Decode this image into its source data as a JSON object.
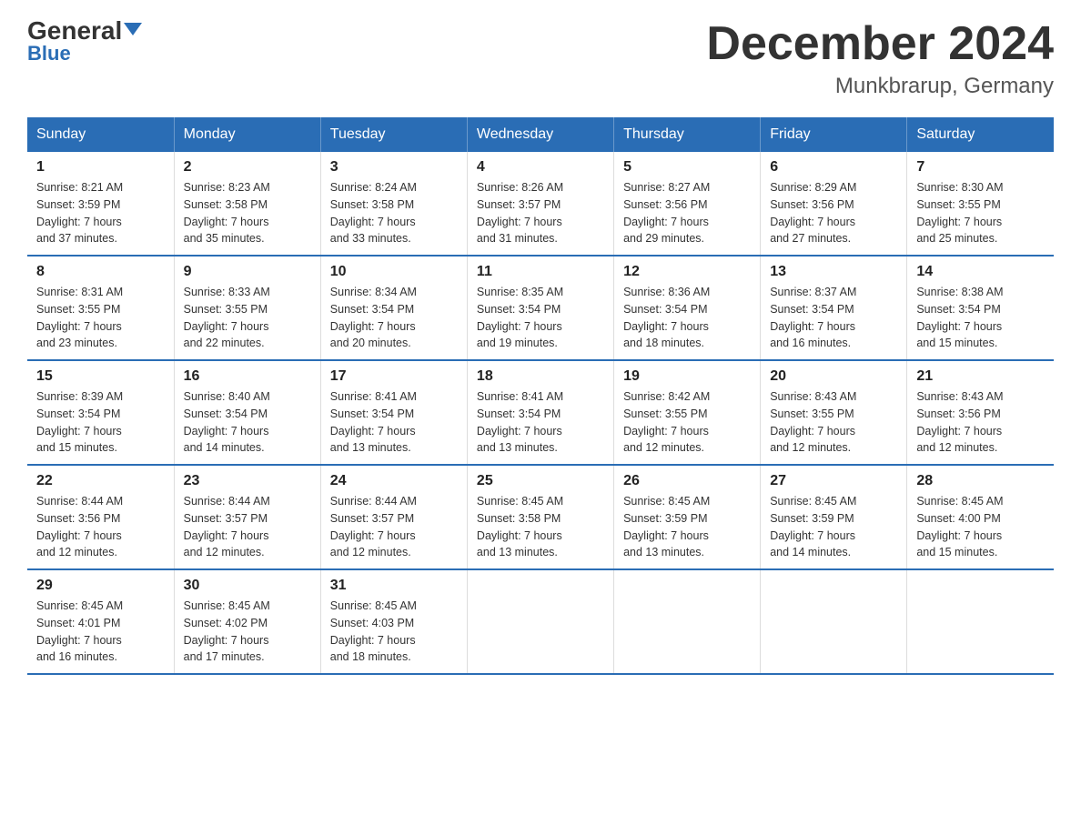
{
  "header": {
    "logo_general": "General",
    "logo_blue": "Blue",
    "main_title": "December 2024",
    "subtitle": "Munkbrarup, Germany"
  },
  "days_of_week": [
    "Sunday",
    "Monday",
    "Tuesday",
    "Wednesday",
    "Thursday",
    "Friday",
    "Saturday"
  ],
  "weeks": [
    [
      {
        "day": "1",
        "info": "Sunrise: 8:21 AM\nSunset: 3:59 PM\nDaylight: 7 hours\nand 37 minutes."
      },
      {
        "day": "2",
        "info": "Sunrise: 8:23 AM\nSunset: 3:58 PM\nDaylight: 7 hours\nand 35 minutes."
      },
      {
        "day": "3",
        "info": "Sunrise: 8:24 AM\nSunset: 3:58 PM\nDaylight: 7 hours\nand 33 minutes."
      },
      {
        "day": "4",
        "info": "Sunrise: 8:26 AM\nSunset: 3:57 PM\nDaylight: 7 hours\nand 31 minutes."
      },
      {
        "day": "5",
        "info": "Sunrise: 8:27 AM\nSunset: 3:56 PM\nDaylight: 7 hours\nand 29 minutes."
      },
      {
        "day": "6",
        "info": "Sunrise: 8:29 AM\nSunset: 3:56 PM\nDaylight: 7 hours\nand 27 minutes."
      },
      {
        "day": "7",
        "info": "Sunrise: 8:30 AM\nSunset: 3:55 PM\nDaylight: 7 hours\nand 25 minutes."
      }
    ],
    [
      {
        "day": "8",
        "info": "Sunrise: 8:31 AM\nSunset: 3:55 PM\nDaylight: 7 hours\nand 23 minutes."
      },
      {
        "day": "9",
        "info": "Sunrise: 8:33 AM\nSunset: 3:55 PM\nDaylight: 7 hours\nand 22 minutes."
      },
      {
        "day": "10",
        "info": "Sunrise: 8:34 AM\nSunset: 3:54 PM\nDaylight: 7 hours\nand 20 minutes."
      },
      {
        "day": "11",
        "info": "Sunrise: 8:35 AM\nSunset: 3:54 PM\nDaylight: 7 hours\nand 19 minutes."
      },
      {
        "day": "12",
        "info": "Sunrise: 8:36 AM\nSunset: 3:54 PM\nDaylight: 7 hours\nand 18 minutes."
      },
      {
        "day": "13",
        "info": "Sunrise: 8:37 AM\nSunset: 3:54 PM\nDaylight: 7 hours\nand 16 minutes."
      },
      {
        "day": "14",
        "info": "Sunrise: 8:38 AM\nSunset: 3:54 PM\nDaylight: 7 hours\nand 15 minutes."
      }
    ],
    [
      {
        "day": "15",
        "info": "Sunrise: 8:39 AM\nSunset: 3:54 PM\nDaylight: 7 hours\nand 15 minutes."
      },
      {
        "day": "16",
        "info": "Sunrise: 8:40 AM\nSunset: 3:54 PM\nDaylight: 7 hours\nand 14 minutes."
      },
      {
        "day": "17",
        "info": "Sunrise: 8:41 AM\nSunset: 3:54 PM\nDaylight: 7 hours\nand 13 minutes."
      },
      {
        "day": "18",
        "info": "Sunrise: 8:41 AM\nSunset: 3:54 PM\nDaylight: 7 hours\nand 13 minutes."
      },
      {
        "day": "19",
        "info": "Sunrise: 8:42 AM\nSunset: 3:55 PM\nDaylight: 7 hours\nand 12 minutes."
      },
      {
        "day": "20",
        "info": "Sunrise: 8:43 AM\nSunset: 3:55 PM\nDaylight: 7 hours\nand 12 minutes."
      },
      {
        "day": "21",
        "info": "Sunrise: 8:43 AM\nSunset: 3:56 PM\nDaylight: 7 hours\nand 12 minutes."
      }
    ],
    [
      {
        "day": "22",
        "info": "Sunrise: 8:44 AM\nSunset: 3:56 PM\nDaylight: 7 hours\nand 12 minutes."
      },
      {
        "day": "23",
        "info": "Sunrise: 8:44 AM\nSunset: 3:57 PM\nDaylight: 7 hours\nand 12 minutes."
      },
      {
        "day": "24",
        "info": "Sunrise: 8:44 AM\nSunset: 3:57 PM\nDaylight: 7 hours\nand 12 minutes."
      },
      {
        "day": "25",
        "info": "Sunrise: 8:45 AM\nSunset: 3:58 PM\nDaylight: 7 hours\nand 13 minutes."
      },
      {
        "day": "26",
        "info": "Sunrise: 8:45 AM\nSunset: 3:59 PM\nDaylight: 7 hours\nand 13 minutes."
      },
      {
        "day": "27",
        "info": "Sunrise: 8:45 AM\nSunset: 3:59 PM\nDaylight: 7 hours\nand 14 minutes."
      },
      {
        "day": "28",
        "info": "Sunrise: 8:45 AM\nSunset: 4:00 PM\nDaylight: 7 hours\nand 15 minutes."
      }
    ],
    [
      {
        "day": "29",
        "info": "Sunrise: 8:45 AM\nSunset: 4:01 PM\nDaylight: 7 hours\nand 16 minutes."
      },
      {
        "day": "30",
        "info": "Sunrise: 8:45 AM\nSunset: 4:02 PM\nDaylight: 7 hours\nand 17 minutes."
      },
      {
        "day": "31",
        "info": "Sunrise: 8:45 AM\nSunset: 4:03 PM\nDaylight: 7 hours\nand 18 minutes."
      },
      {
        "day": "",
        "info": ""
      },
      {
        "day": "",
        "info": ""
      },
      {
        "day": "",
        "info": ""
      },
      {
        "day": "",
        "info": ""
      }
    ]
  ]
}
